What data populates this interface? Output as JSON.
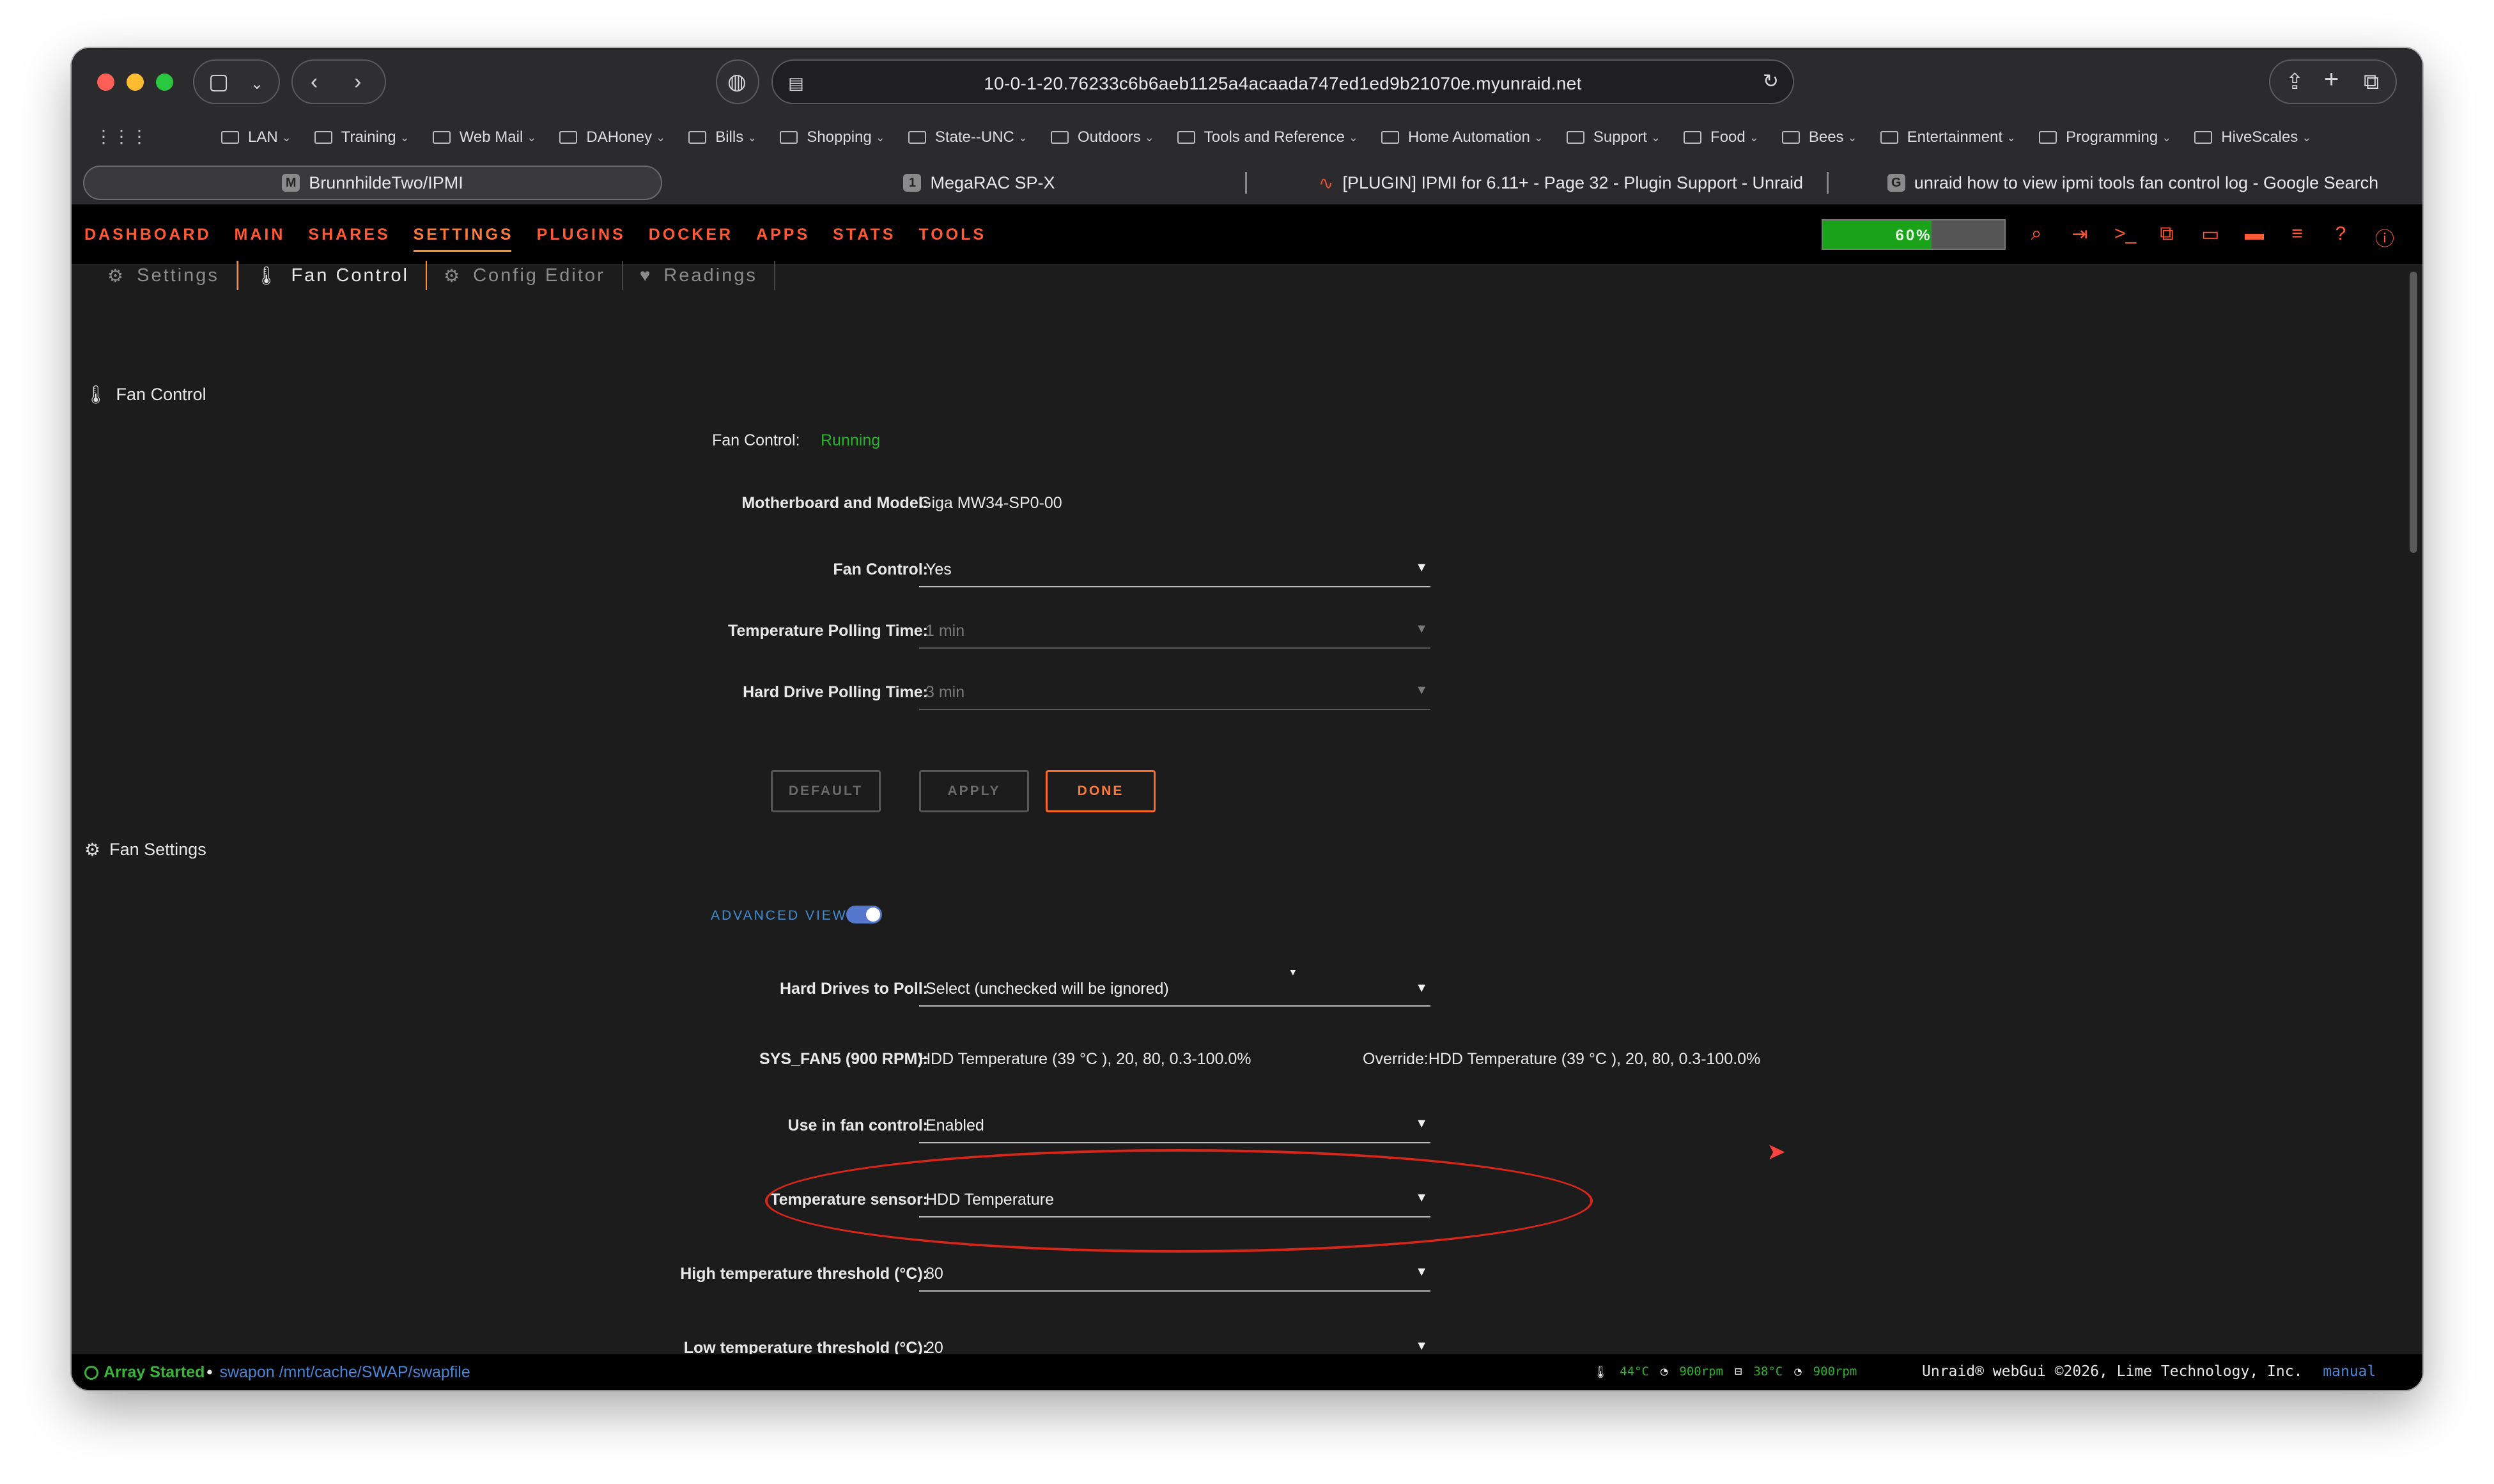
{
  "browser": {
    "url": "10-0-1-20.76233c6b6aeb1125a4acaada747ed1ed9b21070e.myunraid.net",
    "bookmarks": [
      "LAN",
      "Training",
      "Web Mail",
      "DAHoney",
      "Bills",
      "Shopping",
      "State--UNC",
      "Outdoors",
      "Tools and Reference",
      "Home Automation",
      "Support",
      "Food",
      "Bees",
      "Entertainment",
      "Programming",
      "HiveScales"
    ],
    "tabs": [
      {
        "label": "BrunnhildeTwo/IPMI",
        "favicon": "M"
      },
      {
        "label": "MegaRAC SP-X",
        "favicon": "1"
      },
      {
        "label": "[PLUGIN] IPMI for 6.11+ - Page 32 - Plugin Support - Unraid",
        "favicon": "wave"
      },
      {
        "label": "unraid how to view ipmi tools fan control log - Google Search",
        "favicon": "G"
      }
    ]
  },
  "nav": {
    "items": [
      "DASHBOARD",
      "MAIN",
      "SHARES",
      "SETTINGS",
      "PLUGINS",
      "DOCKER",
      "APPS",
      "STATS",
      "TOOLS"
    ],
    "active": "SETTINGS",
    "usage_label": "60%",
    "usage_fraction": 0.6,
    "icons": [
      "search-icon",
      "logout-icon",
      "terminal-icon",
      "copy-icon",
      "chat-icon",
      "monitor-icon",
      "log-icon",
      "help-icon",
      "info-icon"
    ]
  },
  "subtabs": [
    "Settings",
    "Fan Control",
    "Config Editor",
    "Readings"
  ],
  "fan_control_section": {
    "title": "Fan Control",
    "status_label": "Fan Control:",
    "status_value": "Running",
    "motherboard_label": "Motherboard and Model:",
    "motherboard_value": "Giga MW34-SP0-00",
    "fan_control_label": "Fan Control:",
    "fan_control_value": "Yes",
    "temp_polling_label": "Temperature Polling Time:",
    "temp_polling_value": "1 min",
    "hd_polling_label": "Hard Drive Polling Time:",
    "hd_polling_value": "3 min",
    "buttons": {
      "default": "DEFAULT",
      "apply": "APPLY",
      "done": "DONE"
    }
  },
  "fan_settings_section": {
    "title": "Fan Settings",
    "advanced_view": "ADVANCED VIEW",
    "hd_poll_label": "Hard Drives to Poll:",
    "hd_poll_value": "Select (unchecked will be ignored)",
    "fan_label": "SYS_FAN5 (900 RPM):",
    "fan_value": "HDD Temperature (39 °C ), 20, 80, 0.3-100.0%",
    "fan_override": "Override:HDD Temperature (39 °C ), 20, 80, 0.3-100.0%",
    "use_label": "Use in fan control:",
    "use_value": "Enabled",
    "sensor_label": "Temperature sensor:",
    "sensor_value": "HDD Temperature",
    "high_label": "High temperature threshold (°C):",
    "high_value": "80",
    "low_label": "Low temperature threshold (°C):",
    "low_value": "20"
  },
  "statusbar": {
    "array": "Array Started",
    "swap": "swapon /mnt/cache/SWAP/swapfile",
    "cpu_temp": "44°C",
    "fan1": "900rpm",
    "disk_temp": "38°C",
    "fan2": "900rpm",
    "copyright": "Unraid® webGui ©2026, Lime Technology, Inc.",
    "manual": "manual"
  },
  "colors": {
    "accent": "#ff5a36",
    "running": "#2bb32b",
    "highlight_ring": "#d8261b",
    "link": "#4b86d6"
  }
}
